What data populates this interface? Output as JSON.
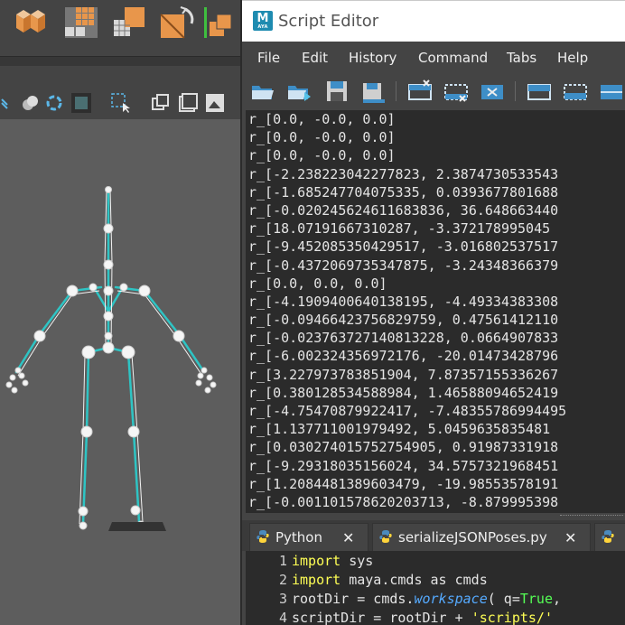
{
  "script_editor": {
    "title": "Script Editor",
    "app_icon_label": "M",
    "app_icon_sublabel": "AYA",
    "menu": [
      "File",
      "Edit",
      "History",
      "Command",
      "Tabs",
      "Help"
    ],
    "output_lines": [
      "r_[0.0, -0.0, 0.0]",
      "r_[0.0, -0.0, 0.0]",
      "r_[0.0, -0.0, 0.0]",
      "r_[-2.238223042277823, 2.3874730533543",
      "r_[-1.685247704075335, 0.0393677801688",
      "r_[-0.020245624611683836, 36.648663440",
      "r_[18.07191667310287, -3.372178995045",
      "r_[-9.452085350429517, -3.016802537517",
      "r_[-0.4372069735347875, -3.24348366379",
      "r_[0.0, 0.0, 0.0]",
      "r_[-4.1909400640138195, -4.49334383308",
      "r_[-0.09466423756829759, 0.47561412110",
      "r_[-0.023763727140813228, 0.0664907833",
      "r_[-6.002324356972176, -20.01473428796",
      "r_[3.227973783851904, 7.87357155336267",
      "r_[0.380128534588984, 1.46588094652419",
      "r_[-4.75470879922417, -7.48355786994495",
      "r_[1.137711001979492, 5.0459635835481",
      "r_[0.030274015752754905, 0.91987331918",
      "r_[-9.29318035156024, 34.5757321968451",
      "r_[1.2084481389603479, -19.98553578191",
      "r_[-0.001101578620203713, -8.879995398"
    ],
    "tabs": [
      {
        "label": "Python"
      },
      {
        "label": "serializeJSONPoses.py"
      }
    ],
    "code": {
      "line_numbers": [
        "1",
        "2",
        "3",
        "4"
      ],
      "line1": {
        "kw": "import",
        "rest": " sys"
      },
      "line2": {
        "kw": "import",
        "rest": " maya.cmds as cmds"
      },
      "line3": {
        "pre": "rootDir = cmds.",
        "fn": "workspace",
        "mid": "( q=",
        "tr": "True",
        "post": ","
      },
      "line4": {
        "pre": "scriptDir = rootDir + ",
        "st": "'scripts/'"
      }
    }
  },
  "colors": {
    "output_bg": "#2b2b2b",
    "panel_bg": "#444444",
    "keyword": "#ffff55",
    "function": "#55aaff",
    "true_literal": "#55ff55",
    "string": "#ffff55",
    "viewport_bg": "#5d5d5d",
    "joint_color": "#f5f5f5",
    "bone_color": "#2ec4c4"
  },
  "icons": {
    "shelf": [
      "cube-shelf-icon",
      "grid-tiles-icon",
      "dotted-grid-icon",
      "orange-grid-icon",
      "rotate-orange-icon",
      "orange-split-icon"
    ],
    "viewport_toolbar": [
      "view-icon",
      "shading-icon",
      "lighting-icon",
      "frame-icon",
      "select-icon",
      "isolate-icon",
      "panel-icon",
      "image-plane-icon"
    ],
    "script_toolbar": [
      "open-script-icon",
      "source-script-icon",
      "save-script-icon",
      "save-to-shelf-icon",
      "clear-history-icon",
      "clear-input-icon",
      "clear-all-icon",
      "show-history-icon",
      "show-input-icon",
      "show-both-icon"
    ]
  }
}
